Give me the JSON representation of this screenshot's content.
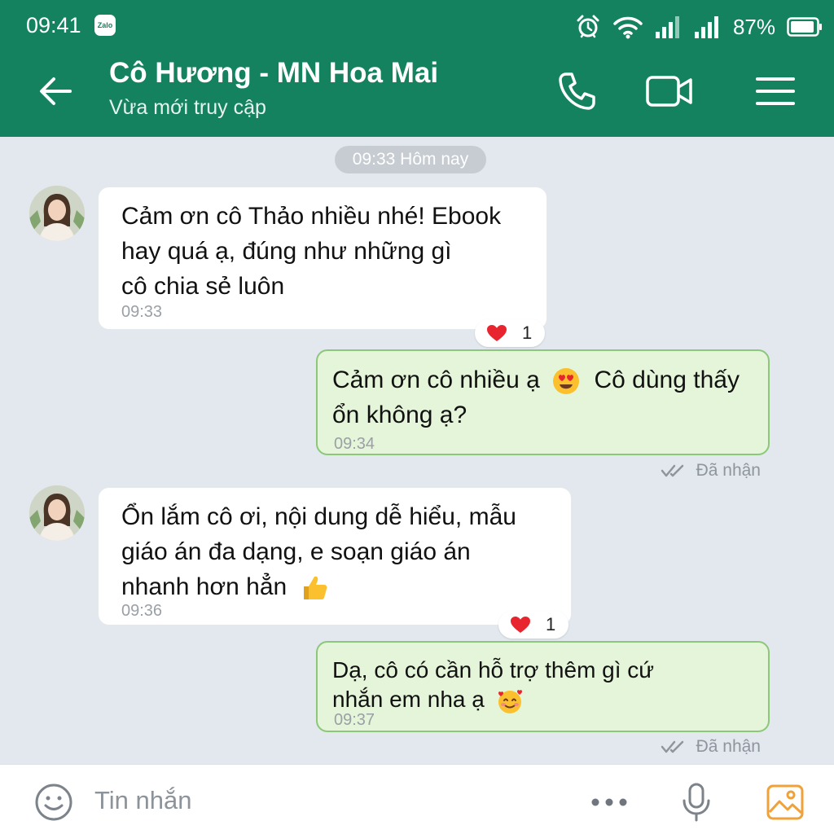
{
  "status_bar": {
    "time": "09:41",
    "app_badge": "Zalo",
    "battery": "87%"
  },
  "header": {
    "contact_name": "Cô Hương - MN Hoa Mai",
    "contact_status": "Vừa mới truy cập",
    "accent_color": "#14825f"
  },
  "chat": {
    "date_divider": "09:33 Hôm nay",
    "messages": [
      {
        "direction": "incoming",
        "lines": [
          "Cảm ơn cô Thảo nhiều nhé! Ebook",
          "hay quá ạ, đúng như những gì",
          "cô chia sẻ luôn"
        ],
        "time": "09:33",
        "reaction": {
          "icon": "heart",
          "count": "1"
        }
      },
      {
        "direction": "outgoing",
        "lines": [
          "Cảm ơn cô nhiều ạ",
          "Cô dùng thấy",
          "ổn không ạ?"
        ],
        "emoji": "heart-eyes",
        "time": "09:34",
        "receipt": "Đã nhận"
      },
      {
        "direction": "incoming",
        "lines": [
          "Ổn lắm cô ơi, nội dung dễ hiểu, mẫu",
          "giáo án đa dạng, e soạn giáo án",
          "nhanh hơn hẳn"
        ],
        "emoji": "thumbs-up",
        "time": "09:36",
        "reaction": {
          "icon": "heart",
          "count": "1"
        }
      },
      {
        "direction": "outgoing",
        "lines": [
          "Dạ, cô có cần hỗ trợ thêm gì cứ",
          "nhắn em nha ạ"
        ],
        "emoji": "smiling-face-with-hearts",
        "time": "09:37",
        "receipt": "Đã nhận"
      }
    ]
  },
  "input_bar": {
    "placeholder": "Tin nhắn"
  }
}
